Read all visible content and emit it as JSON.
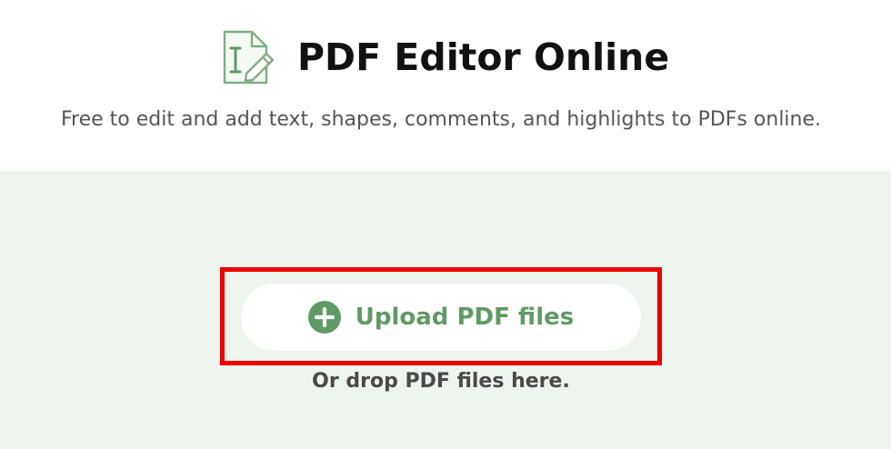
{
  "header": {
    "title": "PDF Editor Online",
    "subtitle": "Free to edit and add text, shapes, comments, and highlights to PDFs online.",
    "icon": "pdf-edit-document-icon"
  },
  "upload": {
    "button_label": "Upload PDF files",
    "icon": "plus-circle-icon",
    "drop_hint": "Or drop PDF files here."
  },
  "colors": {
    "accent_green": "#5f9a65",
    "drop_zone_background": "#eef4ee",
    "highlight_red": "#ee0000",
    "title_text": "#111111",
    "subtitle_text": "#555555"
  }
}
